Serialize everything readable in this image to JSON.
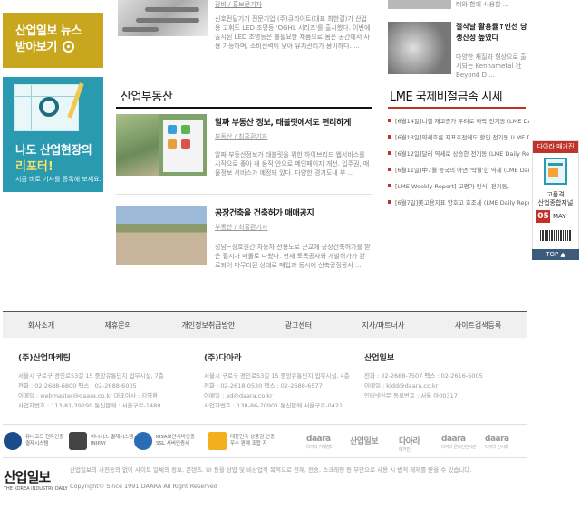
{
  "banners": {
    "news": {
      "line1": "산업일보 뉴스",
      "line2": "받아보기"
    },
    "report": {
      "line1": "나도 산업현장의",
      "line2": "리포터!",
      "line3": "지금 바로 기사를 등록해 보세요."
    }
  },
  "top_articles": [
    {
      "meta": "장비 / 홍보문기자",
      "desc": "신호전달기기 전문기업 (주)큐라이트(대표 최한길)가 산업용 고휘도 LED 조명등 'OGHL 시리즈'를 출시했다. 이번에 출시된 LED 조명등은 불필요한 제품으로 몸은 공간에서 사용 가능하며, 소비전력이 낮아 유지관리가 용이하다. ..."
    },
    {
      "frag": "터와 함께 사용할 ..."
    },
    {
      "title": "절삭날 활용률↑인선 당 생산성 높였다",
      "desc": "다양한 재질과 형상으로 출시되는 Kennametal 社 Beyond D ..."
    }
  ],
  "realestate": {
    "title": "산업부동산",
    "articles": [
      {
        "title": "알짜 부동산 정보, 태블릿에서도 편리하게",
        "meta": "부동산 / 최홍환기자",
        "desc": "알짜 부동산정보가 태블릿을 위한 하이브리드 웹서비스를 시작으로 좋아 내 움직 안으로 메인페이지 개선. 입주권, 매물정보 서비스가 예정돼 있다. 다양한 경기도내 부 ..."
      },
      {
        "title": "공장건축을 건축허가 매매공지",
        "meta": "부동산 / 최홍환기자",
        "desc": "성남~장호원간 자동차 전용도로 근교에 공장건축허가를 받은 필지가 매물로 나왔다. 현재 토목공사와 개발허가가 완료되어 마무리된 상태로 매입과 동시에 신축공정공사 ..."
      }
    ]
  },
  "lme": {
    "title": "LME 국제비철금속 시세",
    "items": [
      "[6월14일]니켈 재고증가 우려로 하락 전기동 (LME Daily Re...",
      "[6월13일]약세흐름 지표호전에도 할인 전기동 (LME Daily...",
      "[6월12일]달러 약세로 상승한 전기동 (LME Daily Report)",
      "[6월11일]中7월 중국의 아연 '탁월'한 약세 (LME Daily ...",
      "[LME Weekly Report] 고평가 인식, 전기동,",
      "[6월7일]美고용지표 양호고 호조세 (LME Daily Report)"
    ]
  },
  "magazine": {
    "header": "다아라 매거진",
    "line1": "고품격",
    "line2": "산업종합저널",
    "num": "05",
    "month": "MAY",
    "top": "TOP ▲"
  },
  "footer": {
    "nav": [
      "회사소개",
      "제휴문의",
      "개인정보취급방안",
      "광고센터",
      "지사/파트너사",
      "사이트검색등록"
    ],
    "companies": [
      {
        "name": "(주)산업마케팅",
        "lines": [
          "서울시 구로구 경인로53길 15 중앙유통단지 업무시설, 7층",
          "전화 : 02-2688-6800  팩스 : 02-2688-6005",
          "이메일 : webmaster@daara.co.kr  대표이사 : 김영환",
          "사업자번호 : 113-81-39299  통신판매 : 서울구로-1489"
        ]
      },
      {
        "name": "(주)다아라",
        "lines": [
          "서울시 구로구 경인로53길 15 중앙유통단지 업무시설, 4층",
          "전화 : 02-2618-0530  팩스 : 02-2688-6577",
          "이메일 : ad@daara.co.kr",
          "사업자번호 : 138-86-70901  통신판매 서울구로-0421"
        ]
      },
      {
        "name": "산업일보",
        "lines": [
          "전화 : 02-2688-7507  팩스 : 02-2616-6005",
          "이메일 : kidd@daara.co.kr",
          "인터넷신문 등록번호 : 서울 아00317"
        ]
      }
    ],
    "certs": [
      {
        "text": "유니코드 전자인증\n결제시스템"
      },
      {
        "text": "이니시스 결제시스템\nINIPAY"
      },
      {
        "text": "KISA보안서버인증\nSSL 서버인증서"
      },
      {
        "text": "대한민국 상품권 인증\n우수 판매 조합 지"
      }
    ],
    "family": [
      {
        "name": "daara",
        "sub": "다아라 기계장터"
      },
      {
        "name": "산업일보",
        "sub": ""
      },
      {
        "name": "다아라",
        "sub": "매거진"
      },
      {
        "name": "daara",
        "sub": "다아라 온라인전시관"
      },
      {
        "name": "daara",
        "sub": "다아라 전시회"
      }
    ],
    "logo": "산업일보",
    "logo_tag": "THE KOREA INDUSTRY DAILY",
    "notice": "산업일보의 사전동의 없이 사이트 일체의 정보, 콘텐츠, UI 등을 상업 및 비상업적 목적으로 전재, 전송, 스크래핑 등 무단으로 사용 시 법적 제재를 받을 수 있습니다.",
    "copyright": "Copyright© Since 1991 DAARA All Right Reserved"
  },
  "colors": {
    "gold": "#c8a61e",
    "teal": "#2a9ab0",
    "red": "#c0332b",
    "navy": "#3c5a7c"
  }
}
